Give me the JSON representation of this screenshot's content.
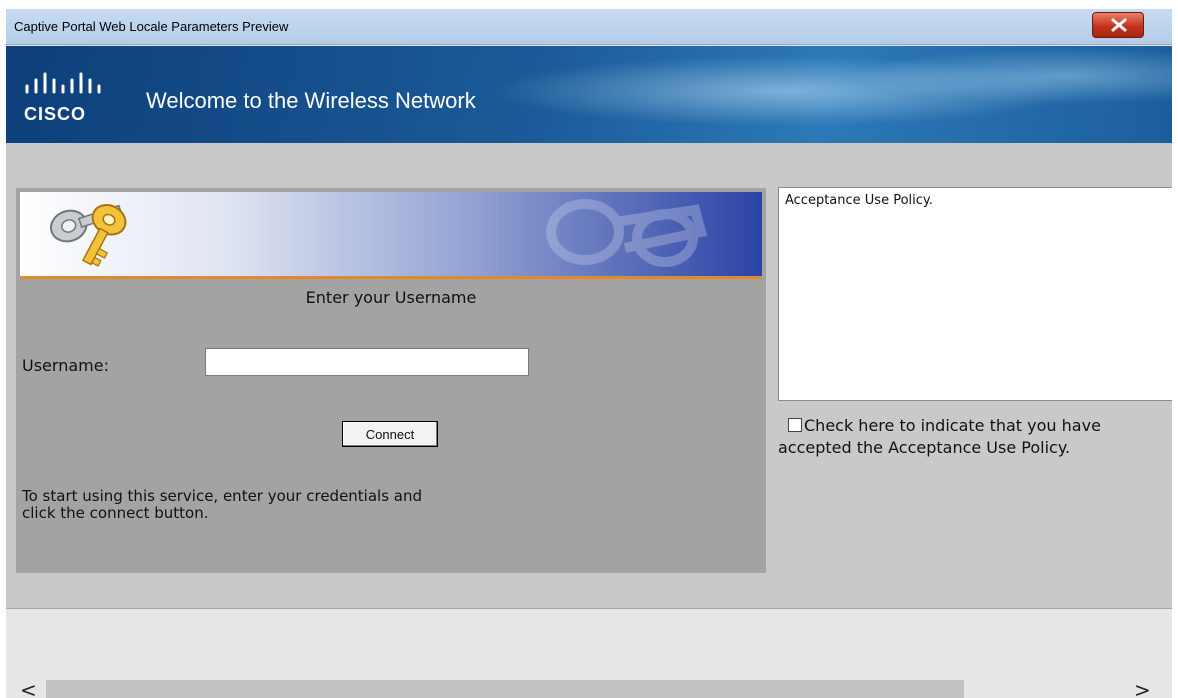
{
  "window": {
    "title": "Captive Portal Web Locale Parameters Preview",
    "close_icon": "close-x-icon"
  },
  "banner": {
    "logo_text": "CISCO",
    "title": "Welcome to the Wireless Network",
    "colors": {
      "banner_dark": "#0d3f7a",
      "banner_light": "#2d79b8"
    }
  },
  "login": {
    "header_icon": "keys-icon",
    "heading": "Enter your Username",
    "username_label": "Username:",
    "username_value": "",
    "connect_label": "Connect",
    "instructions": "To start using this service, enter your credentials and click the connect button.",
    "colors": {
      "panel": "#a3a3a3",
      "header_accent": "#e08a2d"
    }
  },
  "policy": {
    "text": "Acceptance Use Policy.",
    "checked": false,
    "checkbox_label": "Check here to indicate that you have accepted the Acceptance Use Policy."
  },
  "scrollbar": {
    "left_arrow": "<",
    "right_arrow": ">"
  }
}
